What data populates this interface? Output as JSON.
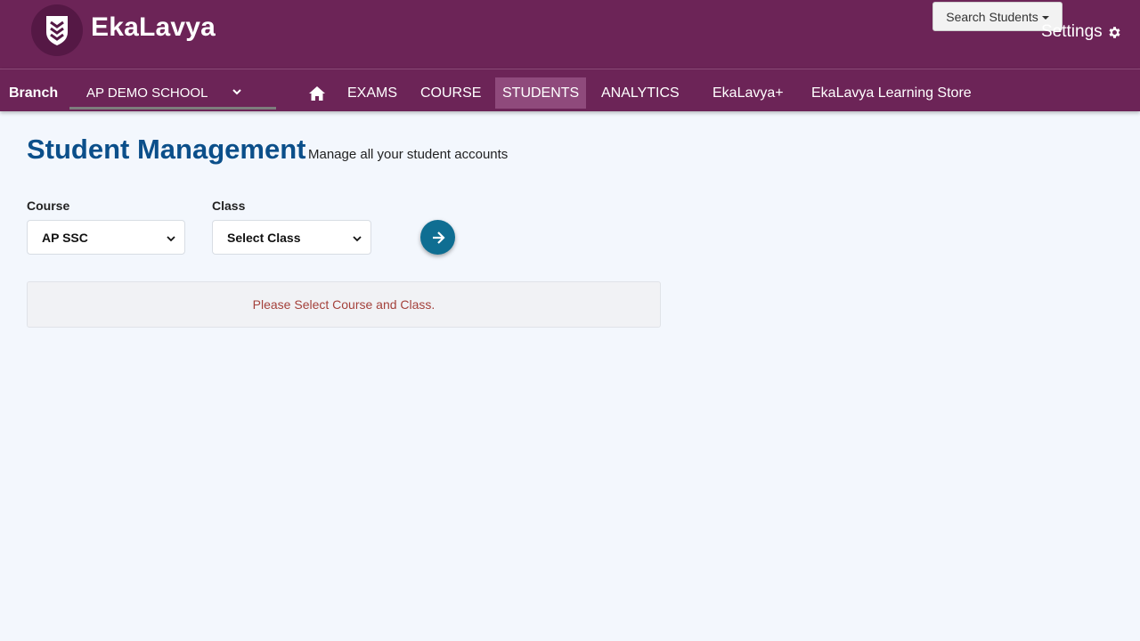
{
  "app": {
    "name": "EkaLavya",
    "logo_icon": "shield-chevrons-icon"
  },
  "header": {
    "search_students_label": "Search Students",
    "settings_label": "Settings",
    "settings_icon": "gear-icon"
  },
  "navbar": {
    "branch_label": "Branch",
    "branch_value": "AP DEMO SCHOOL",
    "home_icon": "home-icon",
    "items": [
      {
        "label": "EXAMS",
        "active": false
      },
      {
        "label": "COURSE",
        "active": false
      },
      {
        "label": "STUDENTS",
        "active": true
      },
      {
        "label": "ANALYTICS",
        "active": false
      },
      {
        "label": "EkaLavya+",
        "active": false
      },
      {
        "label": "EkaLavya Learning Store",
        "active": false
      }
    ]
  },
  "page": {
    "title": "Student Management",
    "subtitle": "Manage all your student accounts"
  },
  "filters": {
    "course_label": "Course",
    "course_value": "AP SSC",
    "class_label": "Class",
    "class_value": "Select Class",
    "go_icon": "arrow-right-icon"
  },
  "notice": {
    "message": "Please Select Course and Class."
  },
  "colors": {
    "header_bg": "#6c2457",
    "active_nav_bg": "#8f4a7c",
    "title": "#0b4f8a",
    "go_button": "#0f6e92",
    "notice_text": "#a4413b",
    "page_bg": "#f3f7fd"
  }
}
